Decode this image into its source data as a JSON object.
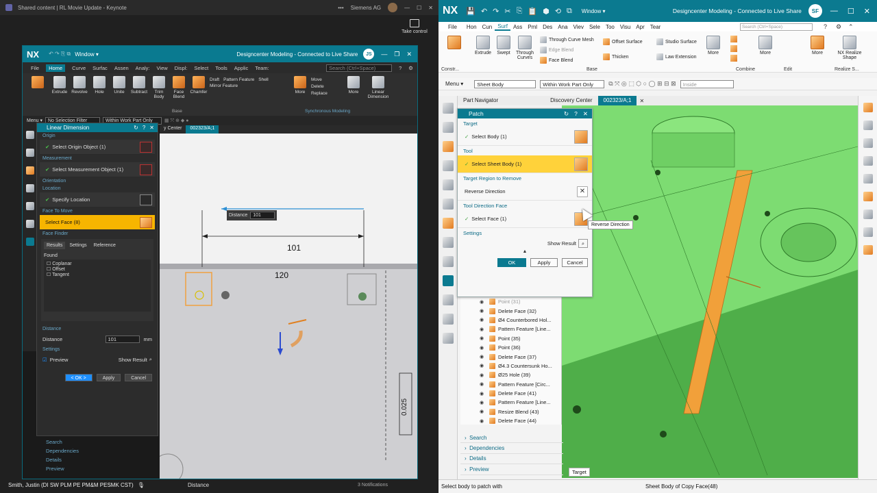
{
  "left": {
    "share_title": "Shared content | RL Movie Update - Keynote",
    "org": "Siemens AG",
    "take_control": "Take control",
    "nx": {
      "logo": "NX",
      "window": "Window ▾",
      "title": "Designcenter Modeling - Connected to Live Share",
      "user": "JS",
      "menu": [
        "File",
        "Home",
        "Curve",
        "Surfac",
        "Assen",
        "Analy:",
        "View",
        "Displ:",
        "Select",
        "Tools",
        "Applic",
        "Team:"
      ],
      "active_menu": "Home",
      "search": "Search (Ctrl+Space)",
      "ribbon": [
        "Extrude",
        "Revolve",
        "Hole",
        "Unite",
        "Subtract",
        "Trim Body",
        "Face Blend",
        "Chamfer",
        "Draft",
        "Shell",
        "Pattern Feature",
        "Mirror Feature",
        "More",
        "Move",
        "Delete",
        "Replace",
        "More",
        "Linear Dimension"
      ],
      "group_base": "Base",
      "group_sync": "Synchronous Modeling",
      "menu_btn": "Menu ▾",
      "filter": "No Selection Filter",
      "scope": "Within Work Part Only",
      "tabs": [
        "y Center",
        "002323/A;1"
      ],
      "dialog": {
        "title": "Linear Dimension",
        "origin_sec": "Origin",
        "origin_row": "Select Origin Object (1)",
        "meas_sec": "Measurement",
        "meas_row": "Select Measurement Object (1)",
        "orient_sec": "Orientation",
        "loc_sec": "Location",
        "loc_row": "Specify Location",
        "ftm_sec": "Face To Move",
        "face_row": "Select Face (8)",
        "finder_sec": "Face Finder",
        "finder_tabs": [
          "Results",
          "Settings",
          "Reference"
        ],
        "found": "Found",
        "found_items": [
          "Coplanar",
          "Offset",
          "Tangent"
        ],
        "dist_sec": "Distance",
        "dist_label": "Distance",
        "dist_value": "101",
        "dist_unit": "mm",
        "settings_sec": "Settings",
        "preview": "Preview",
        "show_result": "Show Result",
        "ok": "< OK >",
        "apply": "Apply",
        "cancel": "Cancel"
      },
      "nav_bottom": [
        "Search",
        "Dependencies",
        "Details",
        "Preview"
      ],
      "canvas": {
        "dist_label": "Distance",
        "dist_value": "101",
        "dim1": "101",
        "dim2": "120",
        "dim3": "0.025"
      }
    },
    "presenter": "Smith, Justin (DI SW PLM PE PM&M PESMK CST)",
    "status_mid": "Distance",
    "notifications": "3 Notifications"
  },
  "right": {
    "logo": "NX",
    "window": "Window ▾",
    "title": "Designcenter Modeling - Connected to Live Share",
    "user": "SF",
    "menu": [
      "File",
      "Hon",
      "Cun",
      "Surf",
      "Ass",
      "Pml",
      "Des",
      "Ana",
      "Viev",
      "Sele",
      "Too",
      "Visu",
      "Apr",
      "Tear"
    ],
    "active_menu": "Surf",
    "search": "Search (Ctrl+Space)",
    "ribbon": {
      "extrude": "Extrude",
      "swept": "Swept",
      "through_curves": "Through Curves",
      "through_curve_mesh": "Through Curve Mesh",
      "edge_blend": "Edge Blend",
      "face_blend": "Face Blend",
      "offset_surface": "Offset Surface",
      "thicken": "Thicken",
      "studio_surface": "Studio Surface",
      "law_extension": "Law Extension",
      "more1": "More",
      "more2": "More",
      "more3": "More",
      "nx_realize": "NX Realize Shape",
      "group_base": "Base",
      "group_combine": "Combine",
      "group_edit": "Edit",
      "group_realize": "Realize S...",
      "group_constr": "Constr..."
    },
    "menu_btn": "Menu ▾",
    "filter": "Sheet Body",
    "scope": "Within Work Part Only",
    "inside": "Inside",
    "tabs": [
      "Part Navigator",
      "Discovery Center",
      "002323/A;1"
    ],
    "patch": {
      "title": "Patch",
      "target_sec": "Target",
      "select_body": "Select Body (1)",
      "tool_sec": "Tool",
      "select_sheet": "Select Sheet Body (1)",
      "trr_sec": "Target Region to Remove",
      "reverse": "Reverse Direction",
      "tdf_sec": "Tool Direction Face",
      "select_face": "Select Face (1)",
      "settings_sec": "Settings",
      "show_result": "Show Result",
      "ok": "OK",
      "apply": "Apply",
      "cancel": "Cancel"
    },
    "tooltip": "Reverse Direction",
    "tree": [
      "Point (31)",
      "Delete Face (32)",
      "Ø4 Counterbored Hol...",
      "Pattern Feature [Line...",
      "Point (35)",
      "Point (36)",
      "Delete Face (37)",
      "Ø4.3 Countersunk Ho...",
      "Ø25 Hole (39)",
      "Pattern Feature [Circ...",
      "Delete Face (41)",
      "Pattern Feature [Line...",
      "Resize Blend (43)",
      "Delete Face (44)"
    ],
    "nav_bottom": [
      "Search",
      "Dependencies",
      "Details",
      "Preview"
    ],
    "target_chip": "Target",
    "status_left": "Select body to patch with",
    "status_mid": "Sheet Body of Copy Face(48)"
  }
}
